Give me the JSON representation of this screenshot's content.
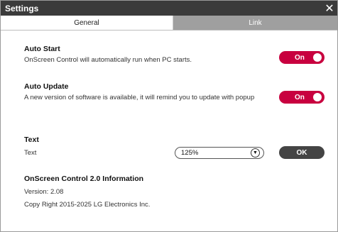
{
  "window": {
    "title": "Settings"
  },
  "tabs": [
    {
      "label": "General",
      "active": true
    },
    {
      "label": "Link",
      "active": false
    }
  ],
  "auto_start": {
    "heading": "Auto Start",
    "description": "OnScreen Control will automatically run when PC starts.",
    "toggle_label": "On"
  },
  "auto_update": {
    "heading": "Auto Update",
    "description": "A new version of software is available, it will remind you to update with popup",
    "toggle_label": "On"
  },
  "text_setting": {
    "heading": "Text",
    "description": "Text",
    "selected": "125%",
    "ok_label": "OK"
  },
  "info": {
    "heading": "OnScreen Control 2.0 Information",
    "version": "Version: 2.08",
    "copyright": "Copy Right 2015-2025 LG Electronics Inc."
  },
  "colors": {
    "titlebar": "#3b3b3b",
    "toggle_on": "#c8003f",
    "inactive_tab": "#9f9f9f",
    "ok_button": "#444444"
  },
  "icons": {
    "close": "close-icon",
    "dropdown": "chevron-down-icon"
  }
}
